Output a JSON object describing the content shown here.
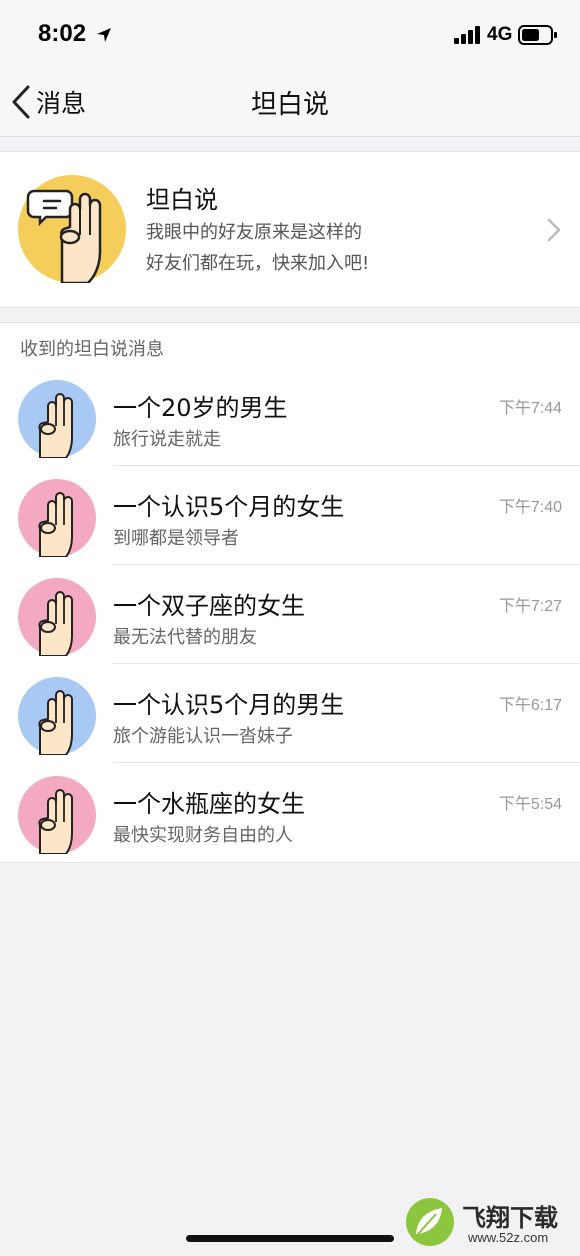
{
  "status_bar": {
    "time": "8:02",
    "network": "4G",
    "icons": [
      "location-arrow-icon",
      "signal-bars-icon",
      "battery-icon"
    ]
  },
  "nav": {
    "back_label": "消息",
    "title": "坦白说",
    "icons": [
      "chevron-left-icon"
    ]
  },
  "promo": {
    "title": "坦白说",
    "line1": "我眼中的好友原来是这样的",
    "line2": "好友们都在玩，快来加入吧!",
    "avatar_color": "#f5cd5a",
    "icons": [
      "speech-bubble-hand-icon",
      "chevron-right-icon"
    ]
  },
  "section": {
    "label": "收到的坦白说消息"
  },
  "colors": {
    "male": "#a9c9f5",
    "female": "#f3a9bf"
  },
  "messages": [
    {
      "title": "一个20岁的男生",
      "preview": "旅行说走就走",
      "time": "下午7:44",
      "gender": "male"
    },
    {
      "title": "一个认识5个月的女生",
      "preview": "到哪都是领导者",
      "time": "下午7:40",
      "gender": "female"
    },
    {
      "title": "一个双子座的女生",
      "preview": "最无法代替的朋友",
      "time": "下午7:27",
      "gender": "female"
    },
    {
      "title": "一个认识5个月的男生",
      "preview": "旅个游能认识一沓妹子",
      "time": "下午6:17",
      "gender": "male"
    },
    {
      "title": "一个水瓶座的女生",
      "preview": "最快实现财务自由的人",
      "time": "下午5:54",
      "gender": "female"
    }
  ],
  "watermark": {
    "title": "飞翔下载",
    "url": "www.52z.com"
  }
}
